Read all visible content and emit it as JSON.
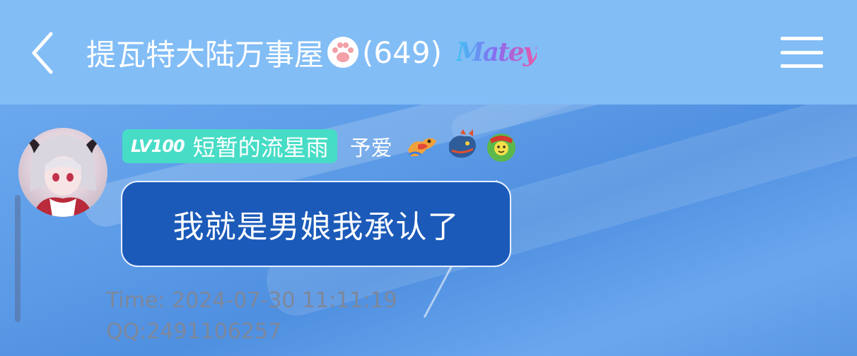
{
  "header": {
    "group_name": "提瓦特大陆万事屋",
    "member_count": "(649)",
    "brand_logo": "Matey"
  },
  "message": {
    "level": "LV100",
    "nickname": "短暂的流星雨",
    "title_tag": "予爱",
    "text": "我就是男娘我承认了",
    "time": "Time: 2024-07-30 11:11:19",
    "qq": "QQ:2491106257"
  },
  "icons": {
    "back": "chevron-left-icon",
    "menu": "hamburger-menu-icon",
    "paw": "paw-icon",
    "emblems": [
      "dragon-badge-icon",
      "dragon-head-icon",
      "green-frog-icon"
    ]
  },
  "colors": {
    "header_bg": "#82bdf6",
    "bubble_bg": "#1b5ab9",
    "level_badge": "#47dcc6",
    "meta_text": "#7d8799"
  }
}
